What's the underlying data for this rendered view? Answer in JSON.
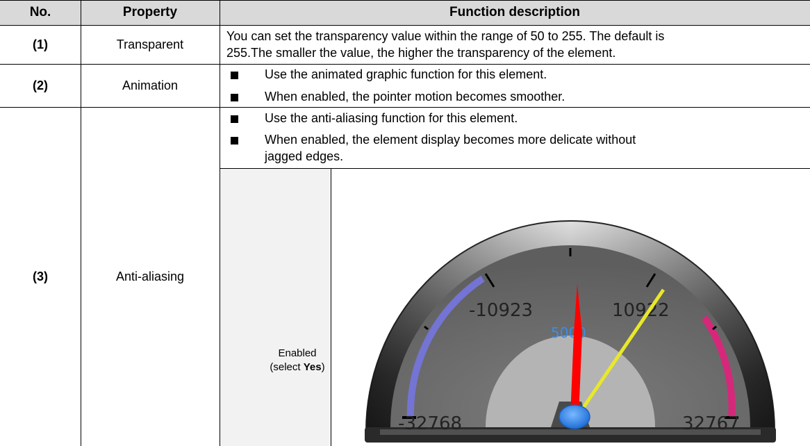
{
  "table": {
    "headers": {
      "no": "No.",
      "property": "Property",
      "function": "Function description"
    },
    "rows": [
      {
        "no": "(1)",
        "property": "Transparent",
        "description": [
          "You can set the transparency value within the range of 50 to 255. The default is",
          "255.The smaller the value, the higher the transparency of the element."
        ]
      },
      {
        "no": "(2)",
        "property": "Animation",
        "bullets": [
          "Use the animated graphic function for this element.",
          "When enabled, the pointer motion becomes smoother."
        ]
      },
      {
        "no": "(3)",
        "property": "Anti-aliasing",
        "bullets": [
          "Use the anti-aliasing function for this element.",
          "When enabled, the element display becomes more delicate without",
          "jagged edges."
        ],
        "sample": {
          "label_line1": "Enabled",
          "label_prefix": "(select ",
          "label_bold": "Yes",
          "label_suffix": ")",
          "gauge": {
            "min_label": "-32768",
            "max_label": "32767",
            "tick_left_label": "-10923",
            "tick_right_label": "10922",
            "value_label": "5000",
            "value_label_color": "#3a8ee6",
            "low_band_color": "#7474d4",
            "high_band_color": "#d6287a",
            "needle_color": "#ff0000",
            "second_needle_color": "#e8e82a",
            "hub_color": "#3a8ef0"
          }
        }
      }
    ]
  }
}
